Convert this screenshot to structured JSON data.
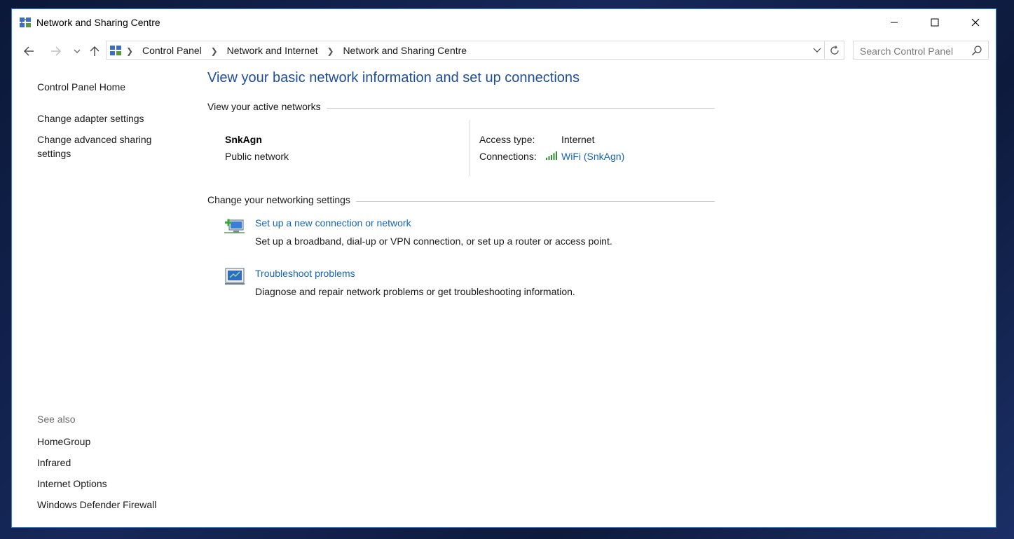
{
  "window": {
    "title": "Network and Sharing Centre"
  },
  "address": {
    "breadcrumbs": [
      "Control Panel",
      "Network and Internet",
      "Network and Sharing Centre"
    ]
  },
  "search": {
    "placeholder": "Search Control Panel"
  },
  "left_pane": {
    "home": "Control Panel Home",
    "links": [
      "Change adapter settings",
      "Change advanced sharing settings"
    ],
    "see_also_label": "See also",
    "see_also": [
      "HomeGroup",
      "Infrared",
      "Internet Options",
      "Windows Defender Firewall"
    ]
  },
  "main": {
    "title": "View your basic network information and set up connections",
    "active_header": "View your active networks",
    "network": {
      "name": "SnkAgn",
      "type": "Public network",
      "access_label": "Access type:",
      "access_value": "Internet",
      "connections_label": "Connections:",
      "connection_value": "WiFi (SnkAgn)"
    },
    "settings_header": "Change your networking settings",
    "tasks": [
      {
        "label": "Set up a new connection or network",
        "desc": "Set up a broadband, dial-up or VPN connection, or set up a router or access point."
      },
      {
        "label": "Troubleshoot problems",
        "desc": "Diagnose and repair network problems or get troubleshooting information."
      }
    ]
  },
  "icons": {
    "app": "network-sharing-icon",
    "back": "back-arrow-icon",
    "forward": "forward-arrow-icon",
    "recent": "chevron-down-icon",
    "up": "up-arrow-icon",
    "refresh": "refresh-icon",
    "search": "search-icon",
    "wifi": "wifi-signal-icon"
  },
  "colors": {
    "accent_title": "#1e4e9a",
    "link": "#1566b7",
    "window_border": "#2d7fd8"
  }
}
